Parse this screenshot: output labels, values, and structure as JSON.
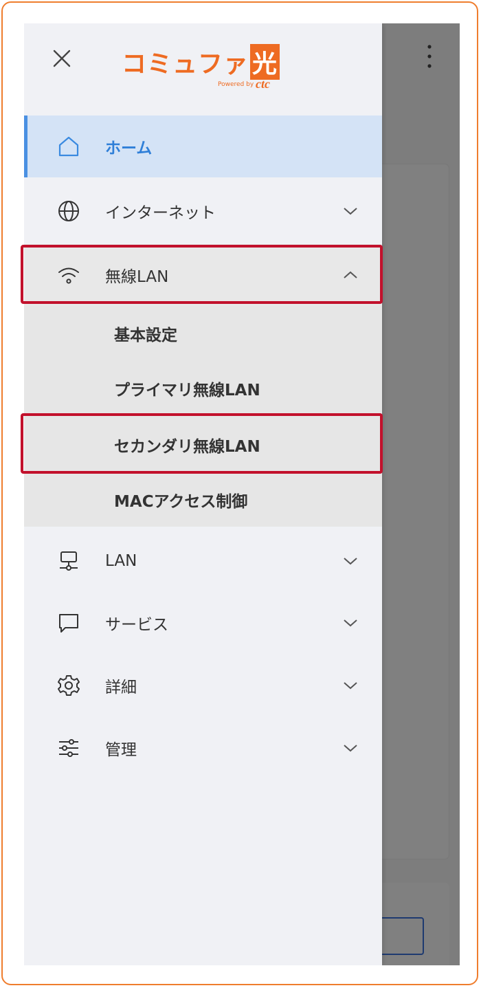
{
  "logo": {
    "main": "コミュファ",
    "box": "光",
    "powered": "Powered by",
    "brand": "ctc"
  },
  "menu": {
    "home": "ホーム",
    "internet": "インターネット",
    "wireless": "無線LAN",
    "lan": "LAN",
    "service": "サービス",
    "detail": "詳細",
    "manage": "管理"
  },
  "submenu": {
    "basic": "基本設定",
    "primary": "プライマリ無線LAN",
    "secondary": "セカンダリ無線LAN",
    "mac": "MACアクセス制御"
  },
  "colors": {
    "accent": "#4a90e2",
    "highlight": "#c2112c",
    "brand": "#ee6b22"
  }
}
